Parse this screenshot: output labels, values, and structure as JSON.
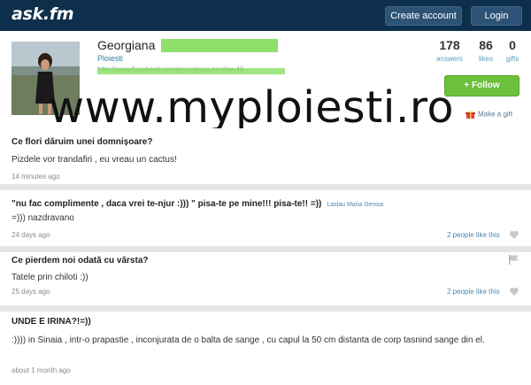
{
  "header": {
    "logo": "ask.fm",
    "create_account": "Create account",
    "login": "Login"
  },
  "profile": {
    "name": "Georgiana",
    "location": "Ploiesti",
    "link": "http://www.facebook.com/georgiana.nicolae.46",
    "stats": [
      {
        "value": "178",
        "label": "answers"
      },
      {
        "value": "86",
        "label": "likes"
      },
      {
        "value": "0",
        "label": "gifts"
      }
    ],
    "follow_label": "+ Follow",
    "gift_label": "Make a gift"
  },
  "watermark": "www.myploiesti.ro",
  "posts": [
    {
      "question": "Ce flori dăruim unei domnișoare?",
      "asker": "",
      "answer": "Pizdele vor trandafiri , eu vreau un cactus!",
      "time": "14 minutes ago",
      "likes": ""
    },
    {
      "question": "\"nu fac complimente , daca vrei te-njur :))) \" pisa-te pe mine!!! pisa-te!! =))",
      "asker": "Laslau Maria Denisa",
      "answer": "=))) nazdravano",
      "time": "24 days ago",
      "likes": "2 people like this"
    },
    {
      "question": "Ce pierdem noi odată cu vârsta?",
      "asker": "",
      "answer": "Tatele prin chiloti :))",
      "time": "25 days ago",
      "likes": "2 people like this"
    },
    {
      "question": "UNDE E IRINA?!=))",
      "asker": "",
      "answer": ":)))) in Sinaia , intr-o prapastie , inconjurata de o balta de sange , cu capul la 50 cm distanta de corp tasnind sange din el.",
      "time": "about 1 month ago",
      "likes": ""
    }
  ]
}
